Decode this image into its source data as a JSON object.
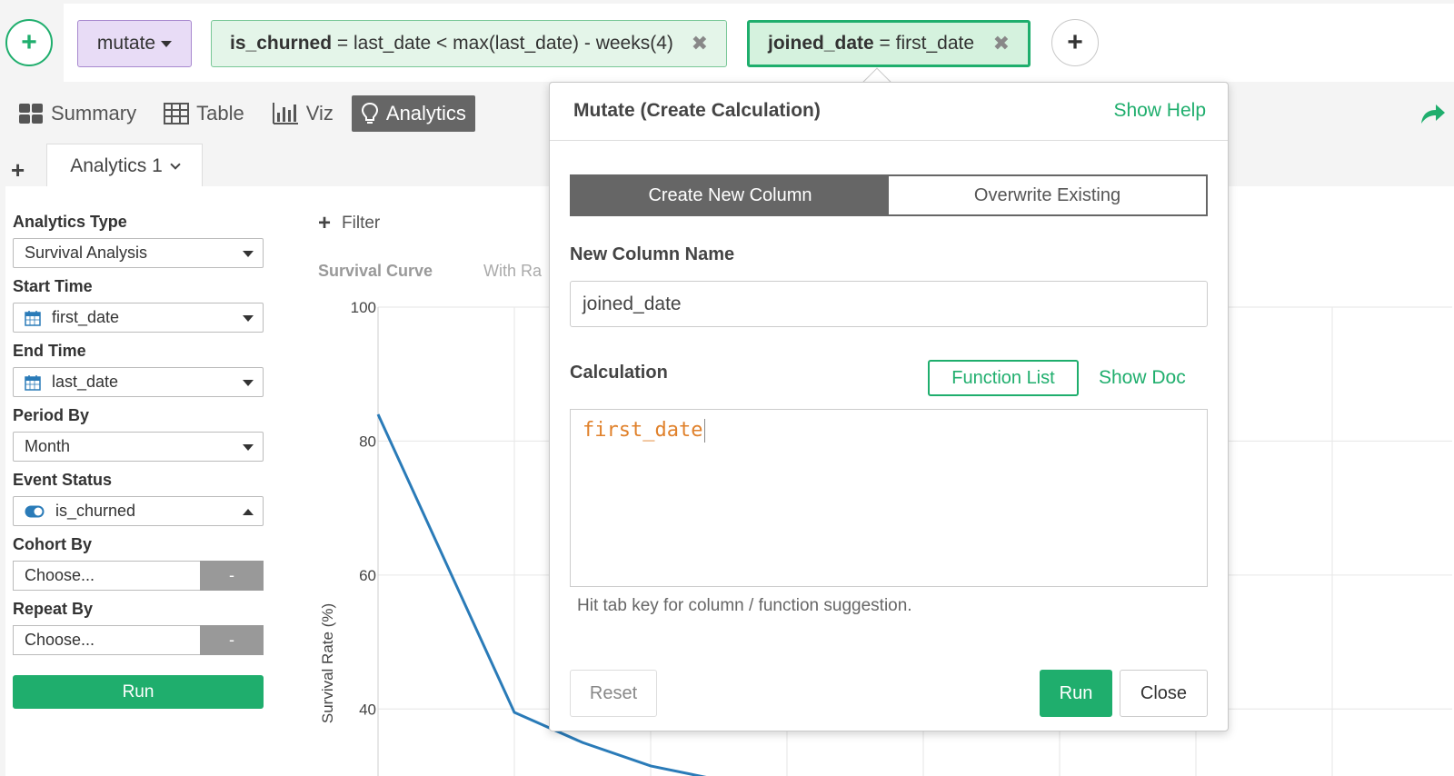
{
  "steps": {
    "command": "mutate",
    "items": [
      {
        "name": "is_churned",
        "expr": " = last_date < max(last_date) - weeks(4)"
      },
      {
        "name": "joined_date",
        "expr": " = first_date"
      }
    ],
    "close_glyph": "✖"
  },
  "view_tabs": [
    {
      "label": "Summary",
      "icon": "grid-icon"
    },
    {
      "label": "Table",
      "icon": "table-icon"
    },
    {
      "label": "Viz",
      "icon": "bar-chart-icon"
    },
    {
      "label": "Analytics",
      "icon": "lightbulb-icon",
      "active": true
    }
  ],
  "analytics_tab": {
    "label": "Analytics 1"
  },
  "settings": {
    "analytics_type": {
      "label": "Analytics Type",
      "value": "Survival Analysis"
    },
    "start_time": {
      "label": "Start Time",
      "value": "first_date"
    },
    "end_time": {
      "label": "End Time",
      "value": "last_date"
    },
    "period_by": {
      "label": "Period By",
      "value": "Month"
    },
    "event_status": {
      "label": "Event Status",
      "value": "is_churned"
    },
    "cohort_by": {
      "label": "Cohort By",
      "value": "Choose...",
      "btn": "-"
    },
    "repeat_by": {
      "label": "Repeat By",
      "value": "Choose...",
      "btn": "-"
    },
    "run_label": "Run"
  },
  "chart_area": {
    "filter_label": "Filter",
    "tab_survival": "Survival Curve",
    "tab_with_rate": "With Ra"
  },
  "chart_data": {
    "type": "line",
    "title": "",
    "xlabel": "",
    "ylabel": "Survival Rate (%)",
    "ylim": [
      30,
      100
    ],
    "yticks": [
      "100",
      "80",
      "60",
      "40"
    ],
    "x": [
      0,
      1,
      1.5,
      2,
      2.6
    ],
    "series": [
      {
        "values": [
          84,
          39.5,
          35,
          31.5,
          29
        ],
        "color": "#2a7bb8"
      }
    ],
    "grid": true
  },
  "popover": {
    "title": "Mutate (Create Calculation)",
    "show_help": "Show Help",
    "mode_new": "Create New Column",
    "mode_overwrite": "Overwrite Existing",
    "new_column_label": "New Column Name",
    "new_column_value": "joined_date",
    "calculation_label": "Calculation",
    "function_list": "Function List",
    "show_doc": "Show Doc",
    "calculation_value": "first_date",
    "hint": "Hit tab key for column / function suggestion.",
    "reset": "Reset",
    "run": "Run",
    "close": "Close"
  },
  "colors": {
    "accent_green": "#1fae6d",
    "line_blue": "#2a7bb8",
    "code_orange": "#e0812b"
  }
}
